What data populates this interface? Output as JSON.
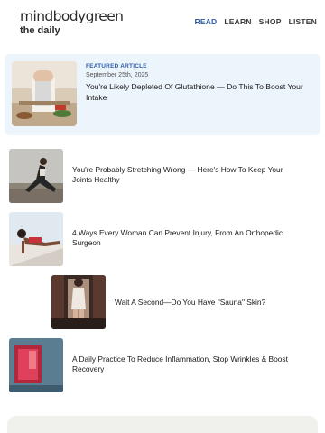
{
  "header": {
    "logo_text": "mindbodygreen",
    "tagline": "the daily",
    "nav": [
      {
        "label": "READ",
        "active": true
      },
      {
        "label": "LEARN",
        "active": false
      },
      {
        "label": "SHOP",
        "active": false
      },
      {
        "label": "LISTEN",
        "active": false
      }
    ]
  },
  "featured": {
    "kicker": "FEATURED ARTICLE",
    "date": "September 25th, 2025",
    "title": "You're Likely Depleted Of Glutathione — Do This To Boost Your Intake",
    "image": "person-cooking-photo"
  },
  "articles": [
    {
      "title": "You're Probably Stretching Wrong — Here's How To Keep Your Joints Healthy",
      "image": "woman-stretching-photo"
    },
    {
      "title": "4 Ways Every Woman Can Prevent Injury, From An Orthopedic Surgeon",
      "image": "woman-plank-photo"
    },
    {
      "title": "Wait A Second—Do You Have \"Sauna\" Skin?",
      "image": "sauna-photo"
    },
    {
      "title": "A Daily Practice To Reduce Inflammation, Stop Wrinkles & Boost Recovery",
      "image": "red-light-panel-photo"
    }
  ],
  "colors": {
    "accent": "#2c5da8",
    "featured_bg": "#edf5fc",
    "card_bg": "#f0f0ec"
  }
}
